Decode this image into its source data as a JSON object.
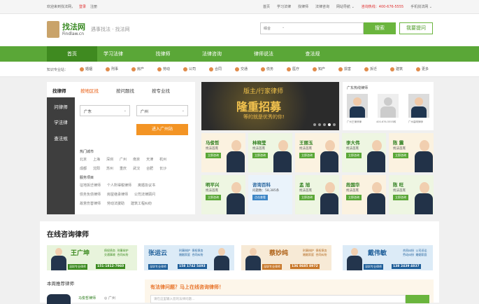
{
  "topbar": {
    "welcome": "欢迎来到找法网，",
    "login": "登录",
    "register": "注册",
    "links": [
      "首页",
      "学习法律",
      "找律师",
      "法律咨询",
      "网站导航 ⌄",
      "咨询热线：400-676-5555",
      "手机找法网 ⌄"
    ]
  },
  "header": {
    "logo_cn": "找法网",
    "logo_en": "Findlaw.cn",
    "slogan": "遇事找法  ·  找法网",
    "search_scope": "综合",
    "search_btn": "搜索",
    "ask_btn": "我要提问"
  },
  "nav": [
    "首页",
    "学习法律",
    "找律师",
    "法律咨询",
    "律师说法",
    "查法规"
  ],
  "categories": {
    "label": "知识专业站：",
    "items": [
      "婚姻",
      "刑事",
      "房产",
      "劳动",
      "公司",
      "合同",
      "交通",
      "债务",
      "医疗",
      "知产",
      "损害",
      "拆迁",
      "建筑",
      "更多"
    ]
  },
  "finder": {
    "tabs": [
      "找律师",
      "按地区找",
      "按问题找",
      "按专业找"
    ],
    "side": [
      "问律师",
      "学法律",
      "查法规"
    ],
    "province": "广东",
    "city": "广州",
    "enter_btn": "进入广州站",
    "hot_title": "热门城市",
    "hot_rows": [
      [
        "北京",
        "上海",
        "深圳",
        "广州",
        "南京",
        "天津",
        "杭州"
      ],
      [
        "成都",
        "沈阳",
        "苏州",
        "重庆",
        "武汉",
        "合肥",
        "长沙"
      ]
    ],
    "svc_title": "服务项目",
    "svc_rows": [
      [
        "征地拆迁律师",
        "个人所得税律师",
        "离婚协议书"
      ],
      [
        "债务负债律师",
        "房屋继承律师",
        "公司法律顾问"
      ],
      [
        "故意伤害律师",
        "劳动法援助",
        "建筑工程纠纷"
      ]
    ]
  },
  "banner": {
    "line1": "版主/行家律师",
    "line2": "隆重招募",
    "line3": "等的就是优秀的你!"
  },
  "gd": {
    "title": "广东热线律师",
    "captions": [
      "广州王律师律",
      "400-676-5555转",
      "广州高明律师"
    ]
  },
  "lawyers": [
    {
      "name": "马俊哲",
      "tag": "找法首席",
      "badge": "立即咨询"
    },
    {
      "name": "林晓莹",
      "tag": "找法首席",
      "badge": "立即咨询"
    },
    {
      "name": "王丽玉",
      "tag": "找法首席",
      "badge": "立即咨询"
    },
    {
      "name": "李大伟",
      "tag": "找法首席",
      "badge": "立即咨询"
    },
    {
      "name": "陈 震",
      "tag": "找法首席",
      "badge": "立即咨询"
    },
    {
      "name": "明平兴",
      "tag": "找法首席",
      "badge": "立即咨询"
    },
    {
      "name": "咨询百科",
      "tag": "问题数：58,385条",
      "badge": "点击查看"
    },
    {
      "name": "孟 旭",
      "tag": "找法首席",
      "badge": "立即咨询"
    },
    {
      "name": "段国华",
      "tag": "找法首席",
      "badge": "立即咨询"
    },
    {
      "name": "陈 旺",
      "tag": "找法首席",
      "badge": "立即咨询"
    }
  ],
  "online": {
    "title": "在线咨询律师",
    "ads": [
      {
        "name": "王广坤",
        "desc": "债权债务  刑事辩护\n交通事故  合同纠纷",
        "tag": "深圳专业律师",
        "phone": "151-1812-7960"
      },
      {
        "name": "张运云",
        "desc": "刑事辩护  债权债务\n婚姻家庭  合同纠纷",
        "tag": "深圳专业律师",
        "phone": "158 1742 5493"
      },
      {
        "name": "蔡妙纯",
        "desc": "刑事辩护  债权债务\n婚姻家庭  合同纠纷",
        "tag": "深圳专业律师",
        "phone": "136 8685 8972"
      },
      {
        "name": "戴伟敏",
        "desc": "合同纠纷  公司诉讼\n劳动纠纷  婚姻家庭",
        "tag": "深圳专业律师",
        "phone": "138 2439 4837"
      }
    ],
    "weekly_title": "本周推荐律师",
    "weekly_name": "马俊哲律师",
    "weekly_city": "◎ 广州",
    "question": "有法律问题？马上在线咨询律师！",
    "question_placeholder": "请在这里输入您的法律问题..."
  },
  "colors": {
    "green": "#5aa737",
    "dark_green": "#3f8a20",
    "orange": "#f39424",
    "red": "#e03030"
  }
}
